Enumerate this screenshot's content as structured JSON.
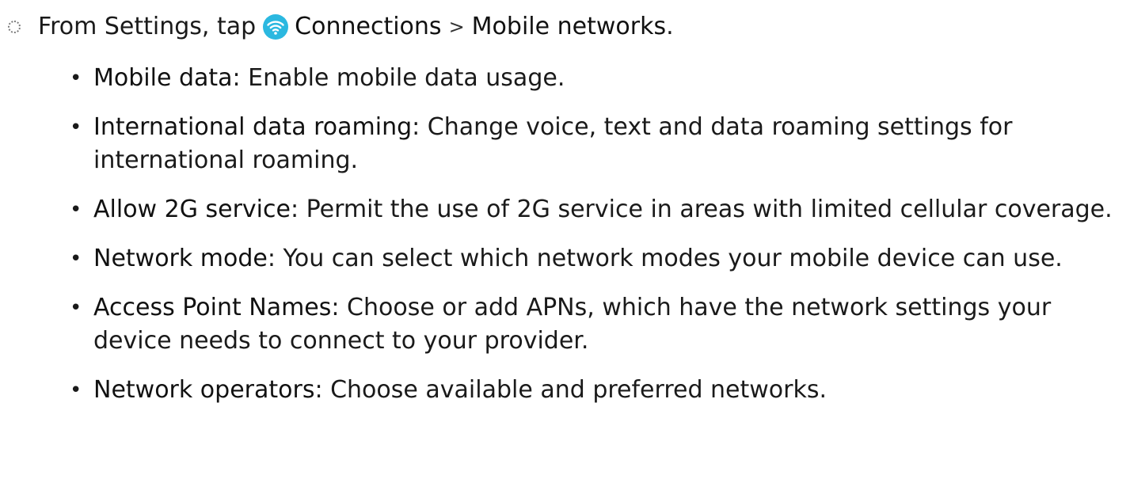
{
  "step": {
    "prefix": "From Settings, tap",
    "icon": "wifi-icon",
    "icon_color": "#2bb8e0",
    "connections": "Connections",
    "separator": ">",
    "mobile_networks": "Mobile networks",
    "suffix": "."
  },
  "options": [
    {
      "term": "Mobile data",
      "desc": ": Enable mobile data usage."
    },
    {
      "term": "International data roaming",
      "desc": ": Change voice, text and data roaming settings for international roaming."
    },
    {
      "term": "Allow 2G service",
      "desc": ": Permit the use of 2G service in areas with limited cellular coverage."
    },
    {
      "term": "Network mode",
      "desc": ": You can select which network modes your mobile device can use."
    },
    {
      "term": "Access Point Names",
      "desc": ": Choose or add APNs, which have the network settings your device needs to connect to your provider."
    },
    {
      "term": "Network operators",
      "desc": ": Choose available and preferred networks."
    }
  ]
}
